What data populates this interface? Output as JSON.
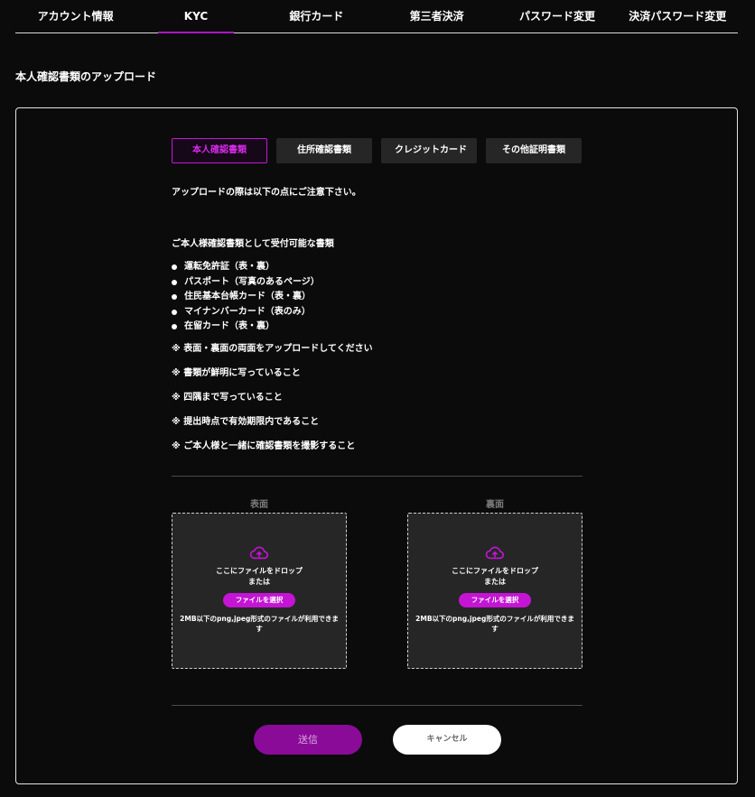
{
  "nav": {
    "tabs": [
      {
        "label": "アカウント情報"
      },
      {
        "label": "KYC"
      },
      {
        "label": "銀行カード"
      },
      {
        "label": "第三者決済"
      },
      {
        "label": "パスワード変更"
      },
      {
        "label": "決済パスワード変更"
      }
    ],
    "active_index": 1
  },
  "section_title": "本人確認書類のアップロード",
  "doc_tabs": [
    {
      "label": "本人確認書類"
    },
    {
      "label": "住所確認書類"
    },
    {
      "label": "クレジットカード"
    },
    {
      "label": "その他証明書類"
    }
  ],
  "doc_tabs_active_index": 0,
  "notice": "アップロードの際は以下の点にご注意下さい。",
  "accepted_title": "ご本人様確認書類として受付可能な書類",
  "accepted_docs": [
    "運転免許証（表・裏）",
    "パスポート（写真のあるページ）",
    "住民基本台帳カード（表・裏）",
    "マイナンバーカード（表のみ）",
    "在留カード（表・裏）"
  ],
  "notes": [
    "※ 表面・裏面の両面をアップロードしてください",
    "※ 書類が鮮明に写っていること",
    "※ 四隅まで写っていること",
    "※ 提出時点で有効期限内であること",
    "※ ご本人様と一緒に確認書類を撮影すること"
  ],
  "upload": {
    "front_label": "表面",
    "back_label": "裏面",
    "drop_text": "ここにファイルをドロップ",
    "or_text": "または",
    "select_button": "ファイルを選択",
    "file_note": "2MB以下のpng,jpeg形式のファイルが利用できます",
    "icon": "cloud-upload-icon"
  },
  "actions": {
    "submit": "送信",
    "cancel": "キャンセル"
  },
  "colors": {
    "accent": "#c414d4",
    "background": "#0b0b0c",
    "panel_fill": "#262627"
  }
}
